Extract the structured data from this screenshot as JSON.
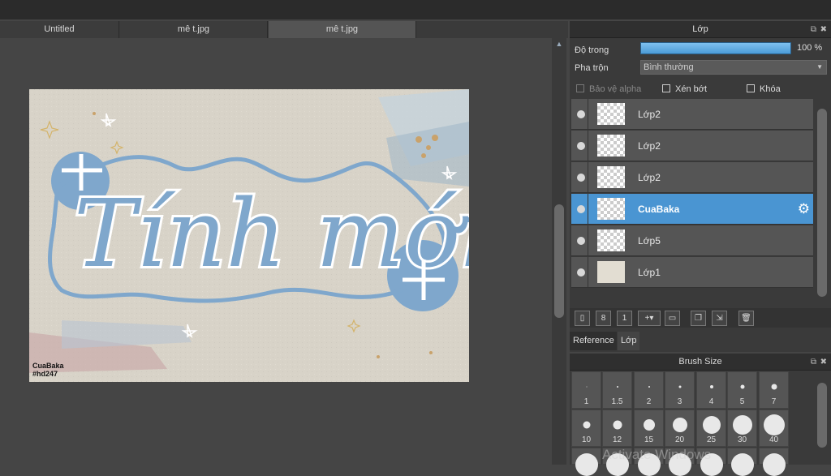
{
  "tabs": [
    {
      "label": "Untitled"
    },
    {
      "label": "mê t.jpg"
    },
    {
      "label": "mê t.jpg"
    }
  ],
  "artwork": {
    "title_text": "Tính mới",
    "signature_line1": "CuaBaka",
    "signature_line2": "#hd247"
  },
  "layer_panel": {
    "title": "Lớp",
    "opacity_label": "Độ trong",
    "opacity_value": "100 %",
    "blend_label": "Pha trộn",
    "blend_value": "Bình thường",
    "protect_alpha": "Bảo vệ alpha",
    "clipping": "Xén bớt",
    "lock": "Khóa",
    "layers": [
      {
        "name": "Lớp2"
      },
      {
        "name": "Lớp2"
      },
      {
        "name": "Lớp2"
      },
      {
        "name": "CuaBaka"
      },
      {
        "name": "Lớp5"
      },
      {
        "name": "Lớp1"
      }
    ],
    "tab_reference": "Reference",
    "tab_layer": "Lớp"
  },
  "brush_panel": {
    "title": "Brush Size",
    "sizes": [
      "1",
      "1.5",
      "2",
      "3",
      "4",
      "5",
      "7",
      "10",
      "12",
      "15",
      "20",
      "25",
      "30",
      "40"
    ]
  },
  "watermark": "Activate Windows",
  "colors": {
    "accent": "#4a95d2",
    "art_blue": "#7fa7cc",
    "art_background": "#d8d3c8"
  }
}
